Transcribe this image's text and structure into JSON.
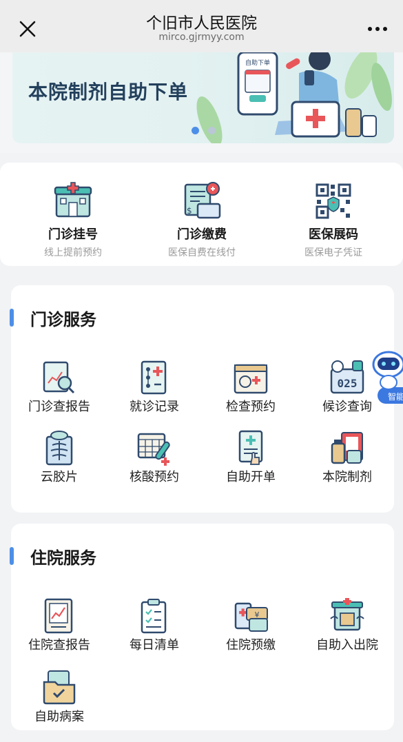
{
  "header": {
    "title": "个旧市人民医院",
    "url": "mirco.gjrmyy.com"
  },
  "banner": {
    "text": "本院制剂自助下单",
    "phone_label": "自助下单",
    "active_dot": 0
  },
  "quick_entries": [
    {
      "label": "门诊挂号",
      "sub": "线上提前预约",
      "icon": "hospital-building-icon"
    },
    {
      "label": "门诊缴费",
      "sub": "医保自费在线付",
      "icon": "payment-bill-icon"
    },
    {
      "label": "医保展码",
      "sub": "医保电子凭证",
      "icon": "qr-code-icon"
    }
  ],
  "outpatient": {
    "title": "门诊服务",
    "items": [
      {
        "label": "门诊查报告",
        "icon": "report-search-icon"
      },
      {
        "label": "就诊记录",
        "icon": "visit-record-icon"
      },
      {
        "label": "检查预约",
        "icon": "exam-calendar-icon"
      },
      {
        "label": "候诊查询",
        "icon": "queue-number-icon"
      },
      {
        "label": "云胶片",
        "icon": "xray-film-icon"
      },
      {
        "label": "核酸预约",
        "icon": "test-tube-calendar-icon"
      },
      {
        "label": "自助开单",
        "icon": "self-order-icon"
      },
      {
        "label": "本院制剂",
        "icon": "medicine-bottles-icon"
      }
    ]
  },
  "inpatient": {
    "title": "住院服务",
    "items": [
      {
        "label": "住院查报告",
        "icon": "report-chart-icon"
      },
      {
        "label": "每日清单",
        "icon": "clipboard-list-icon"
      },
      {
        "label": "住院预缴",
        "icon": "prepay-cash-icon"
      },
      {
        "label": "自助入出院",
        "icon": "admission-discharge-icon"
      },
      {
        "label": "自助病案",
        "icon": "medical-record-folder-icon"
      }
    ]
  },
  "assistant": {
    "label": "智能导",
    "icon": "robot-assistant-icon"
  },
  "colors": {
    "accent": "#4d8fe8",
    "banner_text": "#23405c",
    "icon_teal": "#4bbfb3",
    "icon_red": "#e8565a",
    "icon_navy": "#2f4a6d"
  }
}
